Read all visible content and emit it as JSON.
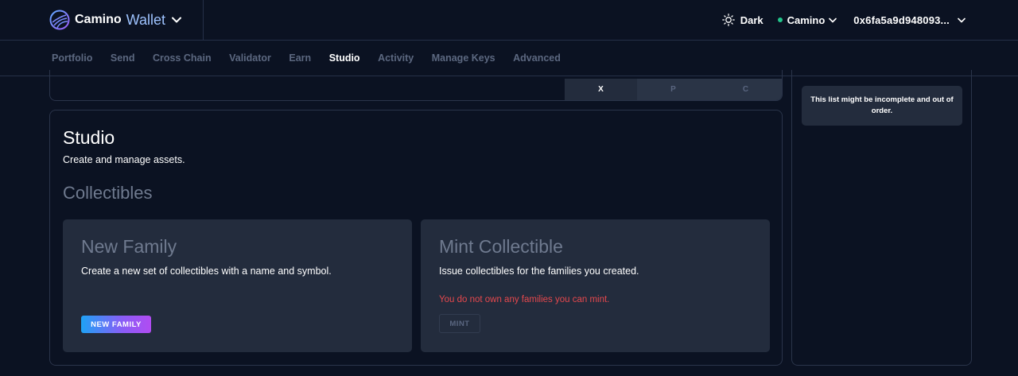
{
  "header": {
    "brand_name": "Camino",
    "brand_product": "Wallet",
    "theme_label": "Dark",
    "network_label": "Camino",
    "address_label": "0x6fa5a9d948093...",
    "network_status_color": "#22c58b"
  },
  "nav": {
    "items": [
      {
        "label": "Portfolio"
      },
      {
        "label": "Send"
      },
      {
        "label": "Cross Chain"
      },
      {
        "label": "Validator"
      },
      {
        "label": "Earn"
      },
      {
        "label": "Studio"
      },
      {
        "label": "Activity"
      },
      {
        "label": "Manage Keys"
      },
      {
        "label": "Advanced"
      }
    ],
    "active": "Studio"
  },
  "chain_switch": {
    "tabs": [
      "X",
      "P",
      "C"
    ],
    "active": "X"
  },
  "side_panel": {
    "notice": "This list might be incomplete and out of order."
  },
  "studio": {
    "title": "Studio",
    "subtitle": "Create and manage assets.",
    "section_title": "Collectibles",
    "new_family": {
      "title": "New Family",
      "description": "Create a new set of collectibles with a name and symbol.",
      "button_label": "NEW FAMILY"
    },
    "mint_collectible": {
      "title": "Mint Collectible",
      "description": "Issue collectibles for the families you created.",
      "warning": "You do not own any families you can mint.",
      "button_label": "MINT"
    }
  },
  "colors": {
    "background": "#0b1222",
    "card": "#232c3d",
    "accent_text": "#9ec3ff",
    "warning": "#e5484d"
  }
}
